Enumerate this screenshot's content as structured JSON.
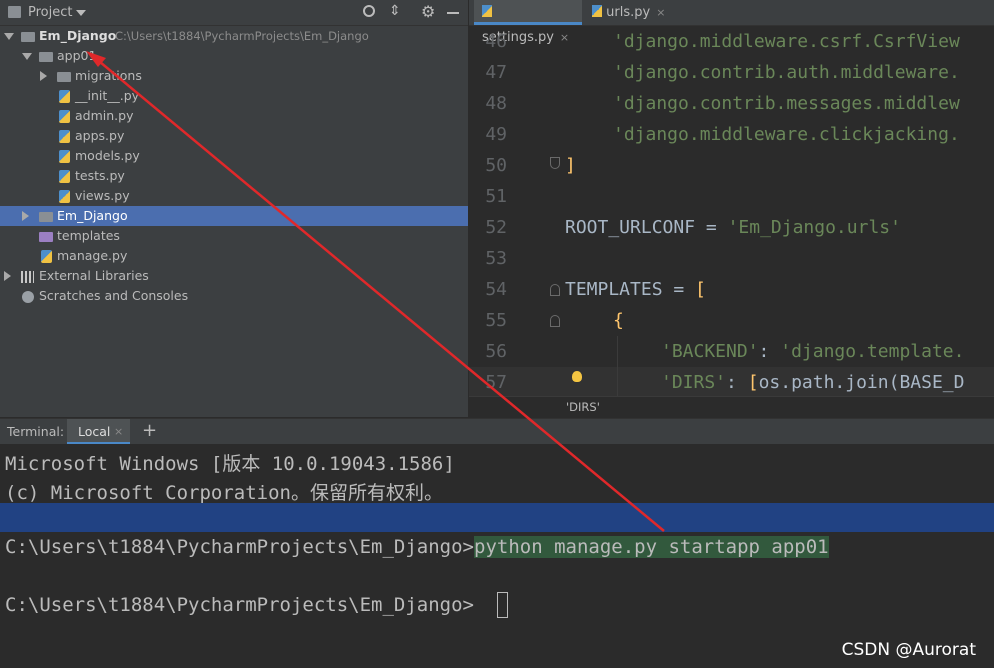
{
  "project_panel": {
    "title": "Project",
    "tree": [
      {
        "label": "Em_Django",
        "path": "C:\\Users\\t1884\\PycharmProjects\\Em_Django"
      },
      {
        "label": "app01"
      },
      {
        "label": "migrations"
      },
      {
        "label": "__init__.py"
      },
      {
        "label": "admin.py"
      },
      {
        "label": "apps.py"
      },
      {
        "label": "models.py"
      },
      {
        "label": "tests.py"
      },
      {
        "label": "views.py"
      },
      {
        "label": "Em_Django"
      },
      {
        "label": "templates"
      },
      {
        "label": "manage.py"
      },
      {
        "label": "External Libraries"
      },
      {
        "label": "Scratches and Consoles"
      }
    ]
  },
  "editor": {
    "tabs": [
      {
        "label": "settings.py",
        "close": "×"
      },
      {
        "label": "urls.py",
        "close": "×"
      }
    ],
    "line_numbers": [
      "46",
      "47",
      "48",
      "49",
      "50",
      "51",
      "52",
      "53",
      "54",
      "55",
      "56",
      "57"
    ],
    "breadcrumb": "'DIRS'"
  },
  "code": {
    "l46": "'django.middleware.csrf.CsrfView",
    "l47": "'django.contrib.auth.middleware.",
    "l48": "'django.contrib.messages.middlew",
    "l49": "'django.middleware.clickjacking.",
    "l50": "]",
    "l52_a": "ROOT_URLCONF = ",
    "l52_b": "'Em_Django.urls'",
    "l54_a": "TEMPLATES = ",
    "l54_b": "[",
    "l55": "{",
    "l56_a": "'BACKEND'",
    "l56_b": ": ",
    "l56_c": "'django.template.",
    "l57_a": "'DIRS'",
    "l57_b": ": ",
    "l57_c": "[",
    "l57_d": "os.path.join(BASE_D"
  },
  "terminal": {
    "label": "Terminal:",
    "tab": "Local",
    "tab_close": "×",
    "add": "+",
    "lines": [
      "Microsoft Windows [版本 10.0.19043.1586]",
      "(c) Microsoft Corporation。保留所有权利。"
    ],
    "prompt1": "C:\\Users\\t1884\\PycharmProjects\\Em_Django>",
    "command": "python manage.py startapp app01",
    "prompt2": "C:\\Users\\t1884\\PycharmProjects\\Em_Django>"
  },
  "watermark": "CSDN @Aurorat",
  "colors": {
    "selection": "#4b6eaf",
    "annotation_arrow": "#e0282a"
  }
}
